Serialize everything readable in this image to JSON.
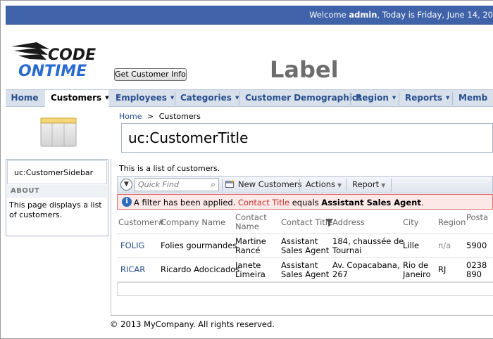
{
  "topbar": {
    "welcome_prefix": "Welcome ",
    "user": "admin",
    "welcome_suffix": ", Today is Friday, June 14, 20"
  },
  "header": {
    "logo_line1": "CODE",
    "logo_line2": "ONTIME",
    "get_button": "Get Customer Info",
    "label": "Label"
  },
  "menu": {
    "items": [
      {
        "label": "Home",
        "arrow": ""
      },
      {
        "label": "Customers",
        "arrow": "▼"
      },
      {
        "label": "Employees",
        "arrow": "▼"
      },
      {
        "label": "Categories",
        "arrow": "▼"
      },
      {
        "label": "Customer Demographics",
        "arrow": ""
      },
      {
        "label": "Region",
        "arrow": "▼"
      },
      {
        "label": "Reports",
        "arrow": "▼"
      },
      {
        "label": "Memb",
        "arrow": ""
      }
    ]
  },
  "sidebar": {
    "title": "uc:CustomerSidebar",
    "about": "ABOUT",
    "description": "This page displays a list of customers."
  },
  "breadcrumb": {
    "home": "Home",
    "separator": ">",
    "current": "Customers"
  },
  "page_title": "uc:CustomerTitle",
  "list_description": "This is a list of customers.",
  "toolbar": {
    "quick_find_placeholder": "Quick Find",
    "new_button": "New Customers",
    "actions": "Actions",
    "report": "Report"
  },
  "filter": {
    "prefix": "A filter has been applied. ",
    "field": "Contact Title",
    "middle": " equals ",
    "value": "Assistant Sales Agent",
    "suffix": "."
  },
  "table": {
    "headers": [
      "Customer#",
      "Company Name",
      "Contact Name",
      "Contact Title",
      "Address",
      "City",
      "Region",
      "Postal Code"
    ],
    "rows": [
      {
        "customer": "FOLIG",
        "company": "Folies gourmandes",
        "contact_l1": "Martine",
        "contact_l2": "Rancé",
        "title_l1": "Assistant",
        "title_l2": "Sales Agent",
        "addr_l1": "184, chaussée de",
        "addr_l2": "Tournai",
        "city_l1": "Lille",
        "city_l2": "",
        "region": "n/a",
        "postal_l1": "5900",
        "postal_l2": ""
      },
      {
        "customer": "RICAR",
        "company": "Ricardo Adocicados",
        "contact_l1": "Janete",
        "contact_l2": "Limeira",
        "title_l1": "Assistant",
        "title_l2": "Sales Agent",
        "addr_l1": "Av. Copacabana,",
        "addr_l2": "267",
        "city_l1": "Rio de",
        "city_l2": "Janeiro",
        "region": "RJ",
        "postal_l1": "0238",
        "postal_l2": "890"
      }
    ]
  },
  "footer": "© 2013 MyCompany. All rights reserved."
}
